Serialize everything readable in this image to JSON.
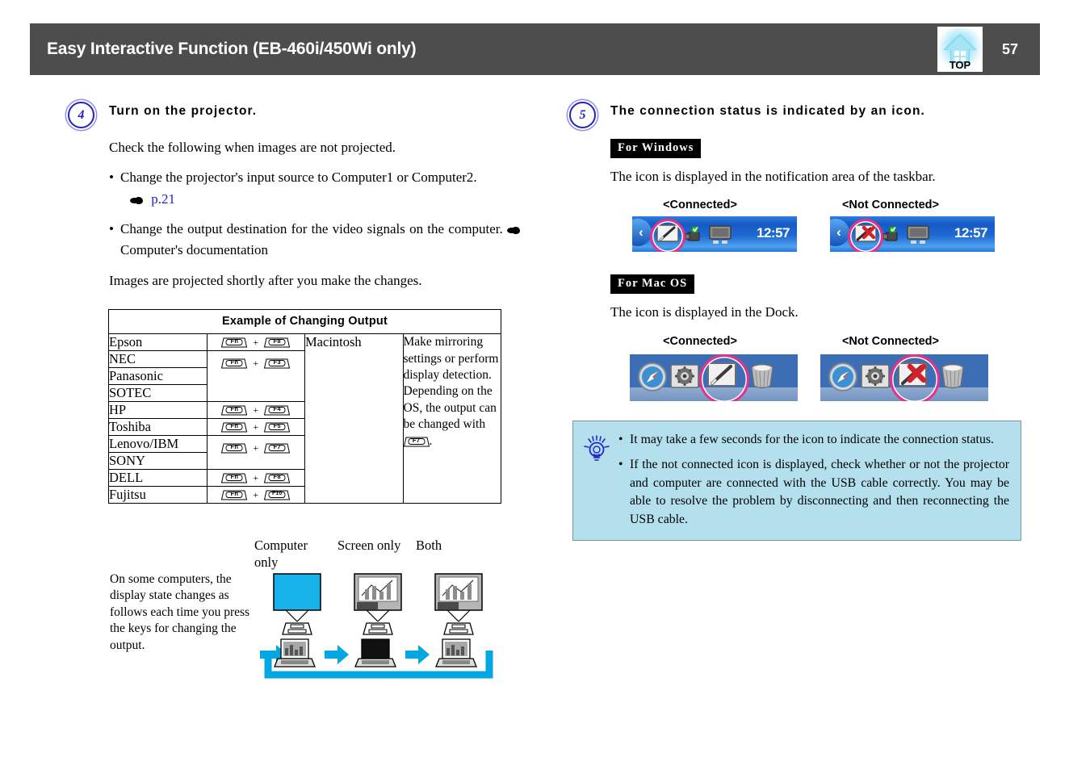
{
  "header": {
    "title": "Easy Interactive Function (EB-460i/450Wi only)",
    "page_number": "57",
    "top_button_label": "TOP",
    "top_button_icon": "home-icon",
    "bar_color": "#4d4d4d"
  },
  "left": {
    "step": {
      "number": "4",
      "heading": "Turn on the projector.",
      "intro": "Check the following when images are not projected.",
      "bullets": [
        {
          "text": "Change the projector's input source to Computer1 or Computer2.",
          "link_text": "p.21",
          "link_color": "#2323c8"
        },
        {
          "text": "Change the output destination for the video signals on the computer.",
          "ref_text": "Computer's documentation"
        }
      ],
      "closing": "Images are projected shortly after you make the changes."
    },
    "table": {
      "caption": "Example of Changing Output",
      "rows": [
        {
          "brand": "Epson",
          "keys": [
            "Fn",
            "F8"
          ]
        },
        {
          "brand": "NEC",
          "keys": [
            "Fn",
            "F3"
          ]
        },
        {
          "brand": "Panasonic",
          "keys": []
        },
        {
          "brand": "SOTEC",
          "keys": []
        },
        {
          "brand": "HP",
          "keys": [
            "Fn",
            "F4"
          ]
        },
        {
          "brand": "Toshiba",
          "keys": [
            "Fn",
            "F5"
          ]
        },
        {
          "brand": "Lenovo/IBM",
          "keys": [
            "Fn",
            "F7"
          ]
        },
        {
          "brand": "SONY",
          "keys": []
        },
        {
          "brand": "DELL",
          "keys": [
            "Fn",
            "F8"
          ]
        },
        {
          "brand": "Fujitsu",
          "keys": [
            "Fn",
            "F10"
          ]
        }
      ],
      "mac_label": "Macintosh",
      "mac_note_part1": "Make mirroring settings or perform display detection. Depending on the OS, the output can be changed with ",
      "mac_note_key": "F7",
      "mac_note_part2": "."
    },
    "diagram": {
      "note": "On some computers, the display state changes as follows each time you press the keys for changing the output.",
      "labels": [
        "Computer only",
        "Screen only",
        "Both"
      ],
      "arrow_color": "#00a7e1",
      "blank_screen_color": "#18b2ea"
    }
  },
  "right": {
    "step": {
      "number": "5",
      "heading": "The connection status is indicated by an icon."
    },
    "windows": {
      "tag": "For  Windows",
      "description": "The icon is displayed in the notification area of the taskbar.",
      "captions": [
        "<Connected>",
        "<Not Connected>"
      ],
      "taskbar_time": "12:57",
      "highlight_color": "#e8308a",
      "icons": [
        "chevron-left-icon",
        "pen-tablet-icon",
        "usb-icon",
        "monitor-icon"
      ]
    },
    "macos": {
      "tag": "For  Mac  OS",
      "description": "The icon is displayed in the Dock.",
      "captions": [
        "<Connected>",
        "<Not Connected>"
      ],
      "highlight_color": "#e8308a",
      "icons": [
        "safari-icon",
        "system-preferences-icon",
        "pen-tablet-icon",
        "trash-icon"
      ]
    },
    "tip": {
      "icon": "lightbulb-icon",
      "background": "#b3e0ec",
      "items": [
        "It may take a few seconds for the icon to indicate the connection status.",
        "If the not connected icon is displayed, check whether or not the projector and computer are connected with the USB cable correctly. You may be able to resolve the problem by disconnecting and then reconnecting the USB cable."
      ]
    }
  }
}
